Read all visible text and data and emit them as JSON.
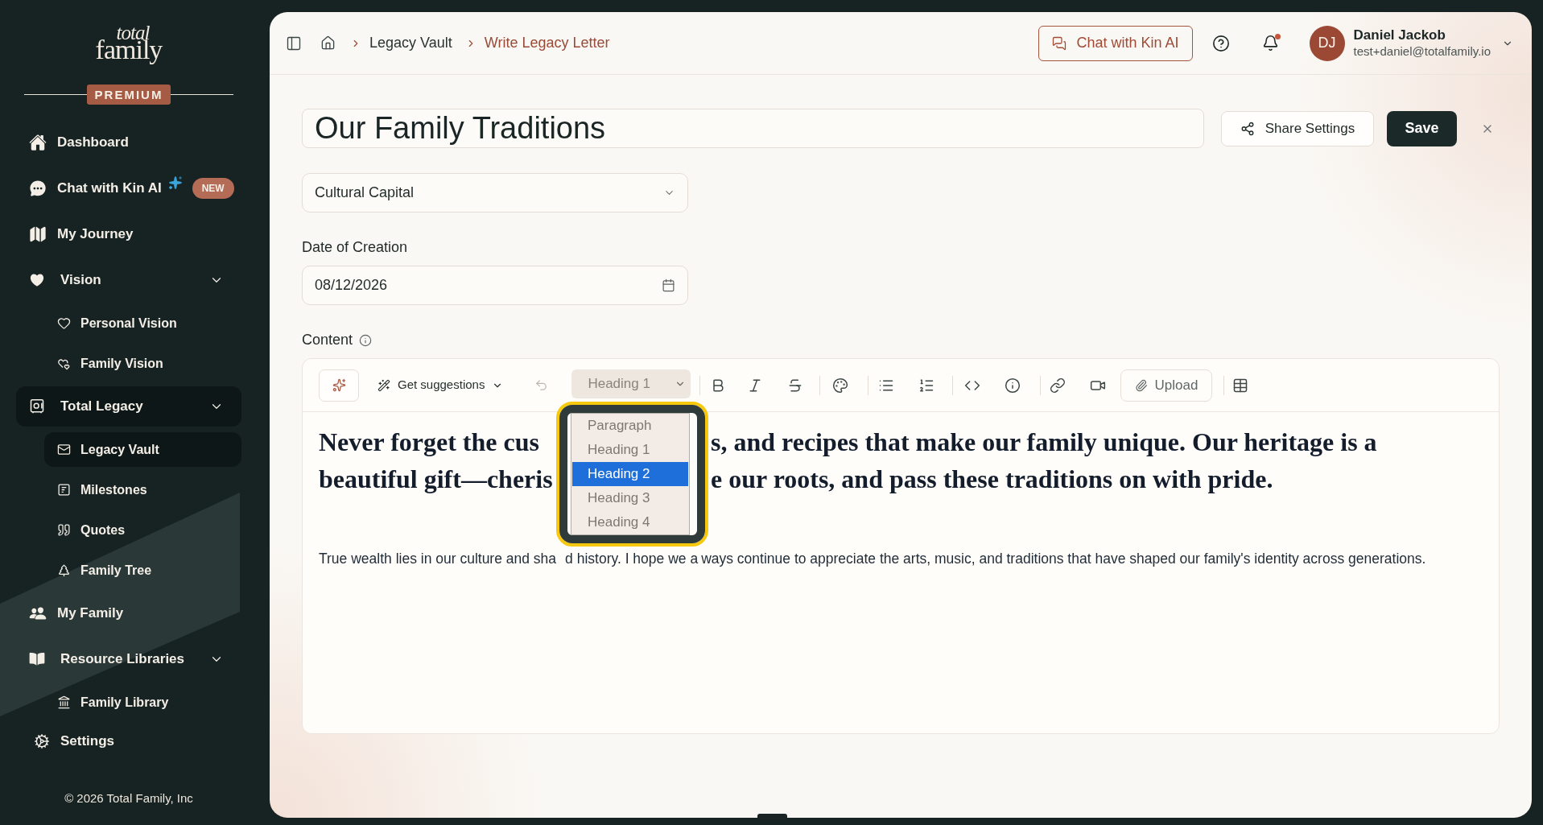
{
  "sidebar": {
    "logo": {
      "top": "total",
      "bottom": "family"
    },
    "plan_badge": "PREMIUM",
    "items": [
      {
        "label": "Dashboard",
        "kind": "link",
        "selected": false
      },
      {
        "label": "Chat with Kin AI",
        "kind": "ai",
        "badge": "NEW",
        "selected": false
      },
      {
        "label": "My Journey",
        "kind": "link",
        "selected": false
      },
      {
        "label": "Vision",
        "kind": "group",
        "selected": false,
        "expanded": true,
        "children": [
          {
            "label": "Personal Vision",
            "selected": false
          },
          {
            "label": "Family Vision",
            "selected": false
          }
        ]
      },
      {
        "label": "Total Legacy",
        "kind": "group",
        "selected": true,
        "expanded": true,
        "children": [
          {
            "label": "Legacy Vault",
            "selected": true
          },
          {
            "label": "Milestones",
            "selected": false
          },
          {
            "label": "Quotes",
            "selected": false
          },
          {
            "label": "Family Tree",
            "selected": false
          }
        ]
      },
      {
        "label": "My Family",
        "kind": "link",
        "selected": false
      },
      {
        "label": "Resource Libraries",
        "kind": "group",
        "selected": false,
        "expanded": true,
        "children": [
          {
            "label": "Family Library",
            "selected": false
          }
        ]
      }
    ],
    "settings": "Settings",
    "footer": "© 2026 Total Family, Inc"
  },
  "header": {
    "breadcrumbs": [
      {
        "label": "Legacy Vault",
        "current": false
      },
      {
        "label": "Write Legacy Letter",
        "current": true
      }
    ],
    "chat_button": "Chat with Kin AI",
    "notifications": {
      "unread": true
    },
    "user": {
      "initials": "DJ",
      "name": "Daniel Jackob",
      "email": "test+daniel@totalfamily.io"
    }
  },
  "form": {
    "title": {
      "value": "Our Family Traditions"
    },
    "share_button": "Share Settings",
    "save_button": "Save",
    "category": {
      "value": "Cultural Capital"
    },
    "date": {
      "label": "Date of Creation",
      "value": "08/12/2026"
    },
    "content_label": "Content"
  },
  "editor": {
    "toolbar": {
      "suggestions": "Get suggestions",
      "undo_disabled": true,
      "block_type": "Heading 1",
      "upload": "Upload"
    },
    "block_menu": [
      {
        "label": "Paragraph",
        "selected": false
      },
      {
        "label": "Heading 1",
        "selected": false
      },
      {
        "label": "Heading 2",
        "selected": true
      },
      {
        "label": "Heading 3",
        "selected": false
      },
      {
        "label": "Heading 4",
        "selected": false
      }
    ],
    "heading_lines": [
      {
        "before_menu": "Never forget the cus",
        "after_menu": "s, and recipes that make our family unique. Our heritage is a"
      },
      {
        "before_menu": "beautiful gift—cheris",
        "after_menu": "e our roots, and pass these traditions on with pride."
      }
    ],
    "paragraph_parts": [
      "True wealth lies in our culture and sha",
      "d history. I hope we a",
      "ways continue to appreciate the arts, music, and traditions that have shaped our family's identity across generations."
    ]
  }
}
